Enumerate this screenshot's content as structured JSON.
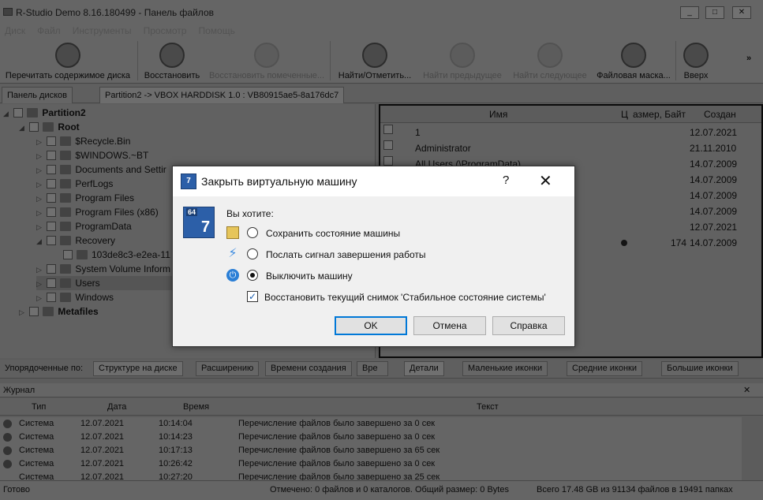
{
  "window": {
    "title": "R-Studio Demo 8.16.180499 - Панель файлов",
    "min": "_",
    "max": "□",
    "close": "✕"
  },
  "menu": [
    "Диск",
    "Файл",
    "Инструменты",
    "Просмотр",
    "Помощь"
  ],
  "toolbar": {
    "rescan": "Перечитать содержимое диска",
    "recover": "Восстановить",
    "recover_marked": "Восстановить помеченные...",
    "find": "Найти/Отметить...",
    "find_prev": "Найти предыдущее",
    "find_next": "Найти следующее",
    "file_mask": "Файловая маска...",
    "up": "Вверх",
    "more": "»"
  },
  "tabs": {
    "disks": "Панель дисков",
    "partition": "Partition2 -> VBOX HARDDISK 1.0 : VB80915ae5-8a176dc7"
  },
  "tree": [
    {
      "label": "Partition2",
      "bold": true,
      "arrow": "◢"
    },
    {
      "label": "Root",
      "bold": true,
      "arrow": "◢"
    },
    {
      "label": "$Recycle.Bin",
      "arrow": "▷"
    },
    {
      "label": "$WINDOWS.~BT",
      "arrow": "▷"
    },
    {
      "label": "Documents and Settir",
      "arrow": "▷"
    },
    {
      "label": "PerfLogs",
      "arrow": "▷"
    },
    {
      "label": "Program Files",
      "arrow": "▷"
    },
    {
      "label": "Program Files (x86)",
      "arrow": "▷"
    },
    {
      "label": "ProgramData",
      "arrow": "▷"
    },
    {
      "label": "Recovery",
      "arrow": "◢"
    },
    {
      "label": "103de8c3-e2ea-11",
      "arrow": ""
    },
    {
      "label": "System Volume Inform",
      "arrow": "▷"
    },
    {
      "label": "Users",
      "arrow": "▷"
    },
    {
      "label": "Windows",
      "arrow": "▷"
    },
    {
      "label": "Metafiles",
      "bold": true,
      "arrow": "▷"
    }
  ],
  "filelist": {
    "headers": {
      "name": "Имя",
      "c": "Ц",
      "size": "азмер, Байт",
      "created": "Создан"
    },
    "rows": [
      {
        "name": "1",
        "size": "",
        "date": "12.07.2021"
      },
      {
        "name": "Administrator",
        "size": "",
        "date": "21.11.2010"
      },
      {
        "name": "All Users (\\ProgramData)",
        "size": "",
        "date": "14.07.2009"
      },
      {
        "name": "",
        "size": "",
        "date": "14.07.2009"
      },
      {
        "name": "",
        "size": "",
        "date": "14.07.2009"
      },
      {
        "name": "",
        "size": "",
        "date": "14.07.2009"
      },
      {
        "name": "",
        "size": "",
        "date": "12.07.2021"
      },
      {
        "name": "",
        "size": "174",
        "date": "14.07.2009"
      }
    ]
  },
  "sortbar": {
    "label": "Упорядоченные по:",
    "by_structure": "Структуре на диске",
    "by_ext": "Расширению",
    "by_created": "Времени создания",
    "by_more": "Вре",
    "details": "Детали",
    "small_icons": "Маленькие иконки",
    "medium_icons": "Средние иконки",
    "large_icons": "Большие иконки"
  },
  "log": {
    "title": "Журнал",
    "close": "✕",
    "headers": {
      "type": "Тип",
      "date": "Дата",
      "time": "Время",
      "text": "Текст"
    },
    "rows": [
      {
        "type": "Система",
        "date": "12.07.2021",
        "time": "10:14:04",
        "text": "Перечисление файлов было завершено за 0 сек"
      },
      {
        "type": "Система",
        "date": "12.07.2021",
        "time": "10:14:23",
        "text": "Перечисление файлов было завершено за 0 сек"
      },
      {
        "type": "Система",
        "date": "12.07.2021",
        "time": "10:17:13",
        "text": "Перечисление файлов было завершено за 65 сек"
      },
      {
        "type": "Система",
        "date": "12.07.2021",
        "time": "10:26:42",
        "text": "Перечисление файлов было завершено за 0 сек"
      },
      {
        "type": "Система",
        "date": "12.07.2021",
        "time": "10:27:20",
        "text": "Перечисление файлов было завершено за 25 сек"
      }
    ]
  },
  "status": {
    "ready": "Готово",
    "marked": "Отмечено: 0 файлов и 0 каталогов. Общий размер: 0 Bytes",
    "total": "Всего 17.48 GB из 91134 файлов в 19491 папках"
  },
  "dialog": {
    "title": "Закрыть виртуальную машину",
    "help": "?",
    "close": "✕",
    "icon_text": "64",
    "icon_num": "7",
    "question": "Вы хотите:",
    "options": [
      {
        "label": "Сохранить состояние машины",
        "selected": false
      },
      {
        "label": "Послать сигнал завершения работы",
        "selected": false
      },
      {
        "label": "Выключить машину",
        "selected": true
      }
    ],
    "restore_snapshot": "Восстановить текущий снимок 'Стабильное состояние системы'",
    "restore_checked": true,
    "check_mark": "✓",
    "ok": "OK",
    "cancel": "Отмена",
    "help_btn": "Справка"
  }
}
